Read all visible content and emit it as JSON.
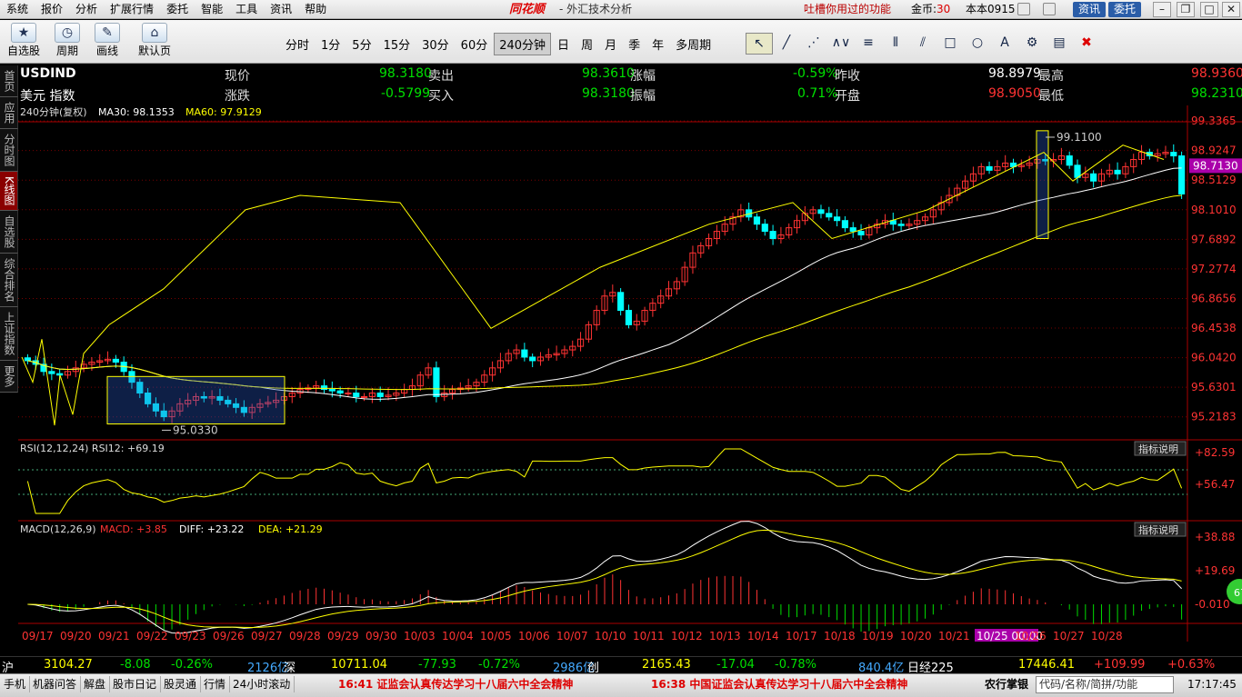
{
  "menu": {
    "items": [
      "系统",
      "报价",
      "分析",
      "扩展行情",
      "委托",
      "智能",
      "工具",
      "资讯",
      "帮助"
    ],
    "logo": "同花顺",
    "title": "- 外汇技术分析",
    "tip": "吐槽你用过的功能",
    "gold_label": "金币:",
    "gold_value": "30",
    "user": "本本0915",
    "btn_news": "资讯",
    "btn_trade": "委托"
  },
  "toolbar": {
    "buttons": [
      {
        "label": "自选股",
        "icon": "star-icon"
      },
      {
        "label": "周期",
        "icon": "clock-icon"
      },
      {
        "label": "画线",
        "icon": "pencil-icon"
      },
      {
        "label": "默认页",
        "icon": "home-icon"
      }
    ],
    "periods": [
      "分时",
      "1分",
      "5分",
      "15分",
      "30分",
      "60分",
      "240分钟",
      "日",
      "周",
      "月",
      "季",
      "年",
      "多周期"
    ],
    "selected_period": "240分钟",
    "tool_glyphs": [
      "↖",
      "╱",
      "⋰",
      "∧∨",
      "≡",
      "⦀",
      "⫽",
      "□",
      "○",
      "A",
      "⚙",
      "▤",
      "✖"
    ]
  },
  "sidebar": {
    "items": [
      "首页",
      "应用",
      "分时图",
      "K线图",
      "自选股",
      "综合排名",
      "上证指数",
      "更多"
    ],
    "active": "K线图"
  },
  "quote": {
    "code": "USDIND",
    "name": "美元 指数",
    "f1": [
      {
        "label": "现价",
        "value": "98.3180",
        "cls": "g"
      },
      {
        "label": "涨跌",
        "value": "-0.5799",
        "cls": "g"
      }
    ],
    "f2": [
      {
        "label": "卖出",
        "value": "98.3610",
        "cls": "g"
      },
      {
        "label": "买入",
        "value": "98.3180",
        "cls": "g"
      }
    ],
    "f3": [
      {
        "label": "涨幅",
        "value": "-0.59%",
        "cls": "g"
      },
      {
        "label": "振幅",
        "value": "0.71%",
        "cls": "g"
      }
    ],
    "f4": [
      {
        "label": "昨收",
        "value": "98.8979",
        "cls": "w"
      },
      {
        "label": "开盘",
        "value": "98.9050",
        "cls": "r"
      }
    ],
    "f5": [
      {
        "label": "最高",
        "value": "98.9360",
        "cls": "r"
      },
      {
        "label": "最低",
        "value": "98.2310",
        "cls": "g"
      }
    ]
  },
  "indicators": {
    "main_label": "240分钟(复权)",
    "ma30": "MA30: 98.1353",
    "ma60": "MA60: 97.9129",
    "rsi": "RSI(12,12,24)  RSI12: +69.19",
    "macd_name": "MACD(12,26,9)",
    "macd": "MACD: +3.85",
    "diff": "DIFF: +23.22",
    "dea": "DEA: +21.29",
    "explain": "指标说明"
  },
  "chart_data": {
    "type": "candlestick",
    "series_name": "USDIND 240分钟",
    "ylim": [
      95.0,
      99.35
    ],
    "y_ticks": [
      "99.3365",
      "98.9247",
      "98.5129",
      "98.1010",
      "97.6892",
      "97.2774",
      "96.8656",
      "96.4538",
      "96.0420",
      "95.6301",
      "95.2183"
    ],
    "current_price_label": "98.7130",
    "annotations": [
      {
        "text": "99.1100",
        "value": 99.11
      },
      {
        "text": "95.0330",
        "value": 95.033
      }
    ],
    "x_ticks": [
      "09/17",
      "09/20",
      "09/21",
      "09/22",
      "09/23",
      "09/26",
      "09/27",
      "09/28",
      "09/29",
      "09/30",
      "10/03",
      "10/04",
      "10/05",
      "10/06",
      "10/07",
      "10/10",
      "10/11",
      "10/12",
      "10/13",
      "10/14",
      "10/17",
      "10/18",
      "10/19",
      "10/20",
      "10/21",
      "10/25 00:00",
      "10/26",
      "10/27",
      "10/28"
    ],
    "closes": [
      96.0,
      95.95,
      95.85,
      95.82,
      95.8,
      95.85,
      95.9,
      95.95,
      95.98,
      96.0,
      96.02,
      95.98,
      95.85,
      95.7,
      95.55,
      95.4,
      95.3,
      95.22,
      95.3,
      95.4,
      95.45,
      95.5,
      95.48,
      95.5,
      95.45,
      95.4,
      95.35,
      95.28,
      95.35,
      95.4,
      95.42,
      95.45,
      95.5,
      95.55,
      95.6,
      95.62,
      95.65,
      95.6,
      95.58,
      95.55,
      95.55,
      95.5,
      95.5,
      95.55,
      95.5,
      95.52,
      95.55,
      95.6,
      95.65,
      95.8,
      95.9,
      95.5,
      95.55,
      95.6,
      95.62,
      95.65,
      95.7,
      95.8,
      95.9,
      96.0,
      96.1,
      96.15,
      96.05,
      96.0,
      96.05,
      96.08,
      96.1,
      96.15,
      96.2,
      96.3,
      96.5,
      96.7,
      96.9,
      96.95,
      96.7,
      96.5,
      96.55,
      96.7,
      96.8,
      96.9,
      97.0,
      97.1,
      97.3,
      97.5,
      97.6,
      97.7,
      97.8,
      97.9,
      98.0,
      98.1,
      98.0,
      97.9,
      97.8,
      97.7,
      97.75,
      97.85,
      97.95,
      98.05,
      98.1,
      98.05,
      98.0,
      97.95,
      97.85,
      97.8,
      97.75,
      97.85,
      97.9,
      97.95,
      97.9,
      97.88,
      97.9,
      97.95,
      98.0,
      98.1,
      98.2,
      98.3,
      98.4,
      98.5,
      98.6,
      98.7,
      98.65,
      98.7,
      98.75,
      98.7,
      98.72,
      98.75,
      98.8,
      98.78,
      98.8,
      98.85,
      98.72,
      98.55,
      98.6,
      98.5,
      98.6,
      98.65,
      98.6,
      98.7,
      98.8,
      98.9,
      98.85,
      98.88,
      98.9,
      98.85,
      98.32
    ],
    "ma30_last": 98.1353,
    "ma60_last": 97.9129,
    "rsi": {
      "ticks": [
        "+82.59",
        "+56.47"
      ],
      "last": 69.19
    },
    "macd": {
      "ticks": [
        "+38.88",
        "+19.69",
        "-0.010"
      ],
      "macd": 3.85,
      "diff": 23.22,
      "dea": 21.29
    }
  },
  "status": {
    "sh": "沪",
    "sh_idx": "3104.27",
    "sh_chg": "-8.08",
    "sh_pct": "-0.26%",
    "sh_amt": "2126亿",
    "sz": "深",
    "sz_idx": "10711.04",
    "sz_chg": "-77.93",
    "sz_pct": "-0.72%",
    "sz_amt": "2986亿",
    "cy": "创",
    "cy_idx": "2165.43",
    "cy_chg": "-17.04",
    "cy_pct": "-0.78%",
    "cy_amt": "840.4亿",
    "rj": "日经225",
    "rj_idx": "17446.41",
    "rj_chg": "+109.99",
    "rj_pct": "+0.63%"
  },
  "bottom": {
    "items": [
      "手机",
      "机器问答",
      "解盘",
      "股市日记",
      "股灵通",
      "行情",
      "24小时滚动"
    ],
    "news1": "16:41 证监会认真传达学习十八届六中全会精神",
    "news2": "16:38 中国证监会认真传达学习十八届六中全会精神",
    "bank": "农行掌银",
    "search_placeholder": "代码/名称/简拼/功能",
    "time": "17:17:45"
  },
  "badge": "67"
}
